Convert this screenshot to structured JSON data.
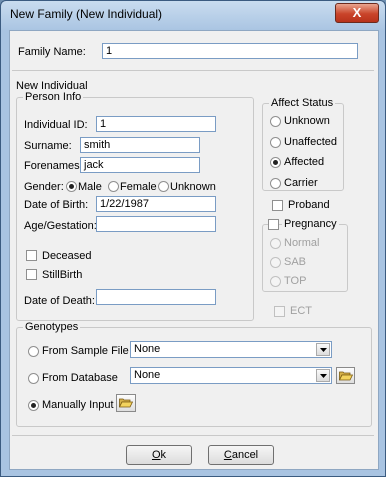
{
  "window": {
    "title": "New Family (New Individual)",
    "close_glyph": "X"
  },
  "family": {
    "label": "Family Name:",
    "value": "1"
  },
  "new_individual_label": "New Individual",
  "person_info": {
    "legend": "Person Info",
    "id_label": "Individual ID:",
    "id_value": "1",
    "surname_label": "Surname:",
    "surname_value": "smith",
    "forenames_label": "Forenames:",
    "forenames_value": "jack",
    "gender_label": "Gender:",
    "gender_options": [
      "Male",
      "Female",
      "Unknown"
    ],
    "gender_selected": "Male",
    "dob_label": "Date of Birth:",
    "dob_value": "1/22/1987",
    "age_label": "Age/Gestation:",
    "age_value": "",
    "deceased_label": "Deceased",
    "stillbirth_label": "StillBirth",
    "dod_label": "Date of Death:",
    "dod_value": ""
  },
  "affect_status": {
    "legend": "Affect Status",
    "options": [
      "Unknown",
      "Unaffected",
      "Affected",
      "Carrier"
    ],
    "selected": "Affected"
  },
  "proband_label": "Proband",
  "pregnancy": {
    "label": "Pregnancy",
    "options": [
      "Normal",
      "SAB",
      "TOP"
    ]
  },
  "ect_label": "ECT",
  "genotypes": {
    "legend": "Genotypes",
    "sample_file_label": "From Sample File",
    "sample_file_value": "None",
    "database_label": "From Database",
    "database_value": "None",
    "manual_label": "Manually Input",
    "selected": "Manually Input"
  },
  "buttons": {
    "ok_key": "O",
    "ok_rest": "k",
    "cancel_key": "C",
    "cancel_rest": "ancel"
  },
  "icons": {
    "close": "close-icon",
    "dropdown": "chevron-down-icon",
    "folder": "folder-open-icon"
  }
}
